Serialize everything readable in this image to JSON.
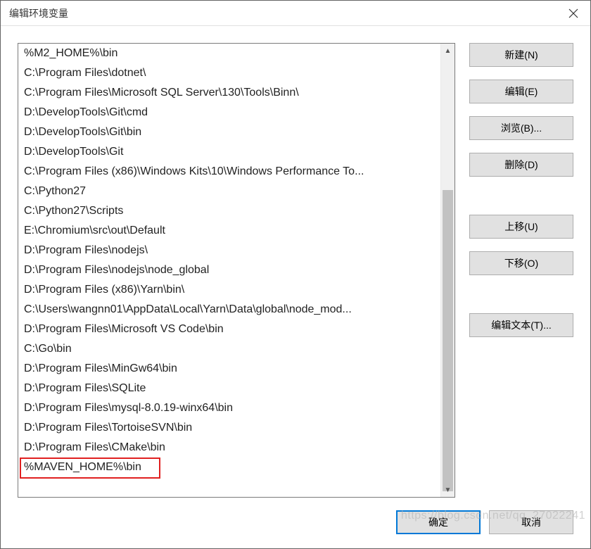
{
  "title": "编辑环境变量",
  "list_items": [
    "%M2_HOME%\\bin",
    "C:\\Program Files\\dotnet\\",
    "C:\\Program Files\\Microsoft SQL Server\\130\\Tools\\Binn\\",
    "D:\\DevelopTools\\Git\\cmd",
    "D:\\DevelopTools\\Git\\bin",
    "D:\\DevelopTools\\Git",
    "C:\\Program Files (x86)\\Windows Kits\\10\\Windows Performance To...",
    "C:\\Python27",
    "C:\\Python27\\Scripts",
    "E:\\Chromium\\src\\out\\Default",
    "D:\\Program Files\\nodejs\\",
    "D:\\Program Files\\nodejs\\node_global",
    "D:\\Program Files (x86)\\Yarn\\bin\\",
    "C:\\Users\\wangnn01\\AppData\\Local\\Yarn\\Data\\global\\node_mod...",
    "D:\\Program Files\\Microsoft VS Code\\bin",
    "C:\\Go\\bin",
    "D:\\Program Files\\MinGw64\\bin",
    "D:\\Program Files\\SQLite",
    "D:\\Program Files\\mysql-8.0.19-winx64\\bin",
    "D:\\Program Files\\TortoiseSVN\\bin",
    "D:\\Program Files\\CMake\\bin",
    "%MAVEN_HOME%\\bin"
  ],
  "buttons": {
    "new": "新建(N)",
    "edit": "编辑(E)",
    "browse": "浏览(B)...",
    "del": "删除(D)",
    "moveup": "上移(U)",
    "movedown": "下移(O)",
    "edittext": "编辑文本(T)..."
  },
  "footer": {
    "ok": "确定",
    "cancel": "取消"
  },
  "watermark": "https://blog.csdn.net/qq_27022241"
}
